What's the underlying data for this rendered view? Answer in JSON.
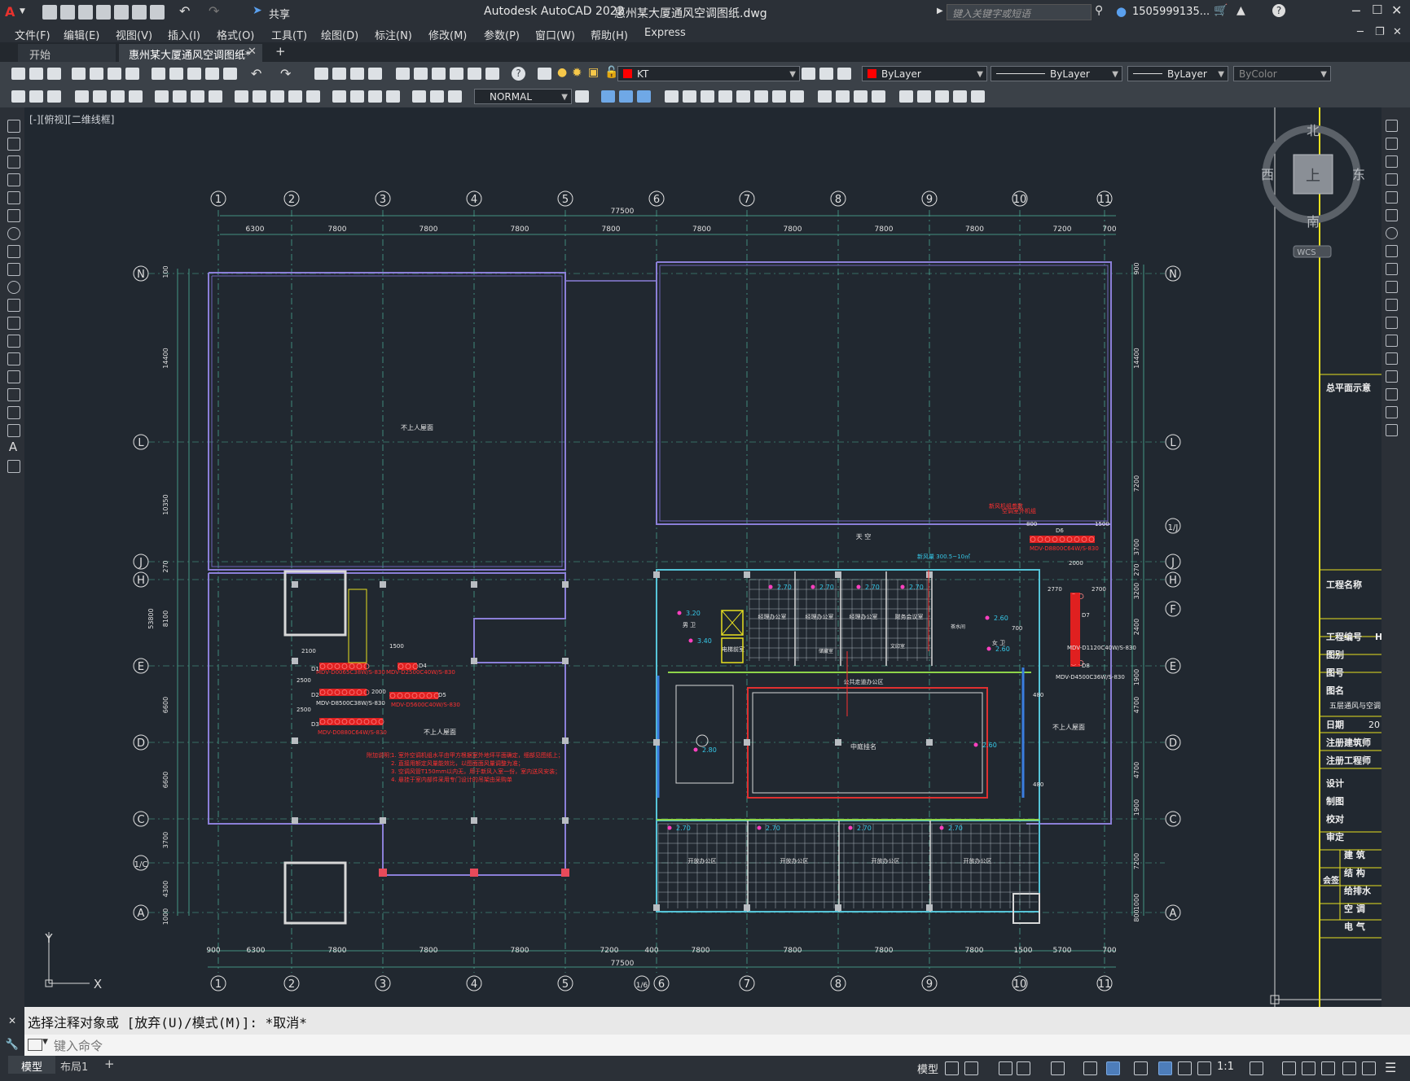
{
  "title_bar": {
    "app_title": "Autodesk AutoCAD 2022",
    "document_name": "惠州某大厦通风空调图纸.dwg",
    "share_label": "共享",
    "search_placeholder": "键入关键字或短语",
    "user": "1505999135..."
  },
  "menu": [
    "文件(F)",
    "编辑(E)",
    "视图(V)",
    "插入(I)",
    "格式(O)",
    "工具(T)",
    "绘图(D)",
    "标注(N)",
    "修改(M)",
    "参数(P)",
    "窗口(W)",
    "帮助(H)",
    "Express"
  ],
  "tabs": {
    "start": "开始",
    "active": "惠州某大厦通风空调图纸*",
    "add": "+"
  },
  "toolbar": {
    "layer": "KT",
    "color": "ByLayer",
    "linetype": "ByLayer",
    "lineweight": "ByLayer",
    "plotstyle": "ByColor",
    "dimstyle": "NORMAL",
    "layer_color": "#ff0000"
  },
  "viewport": {
    "label": "[-][俯视][二维线框]",
    "viewcube": {
      "north": "北",
      "south": "南",
      "east": "东",
      "west": "西",
      "face": "上",
      "wcs": "WCS"
    },
    "ucs_x": "X",
    "ucs_y": "Y"
  },
  "drawing": {
    "top_total": "77500",
    "bottom_total": "77500",
    "col_axes": [
      "1",
      "2",
      "3",
      "4",
      "5",
      "6",
      "7",
      "8",
      "9",
      "10",
      "11"
    ],
    "bottom_col_axes": [
      "1",
      "2",
      "3",
      "4",
      "5",
      "1/6",
      "6",
      "7",
      "8",
      "9",
      "10",
      "11"
    ],
    "top_dims": [
      "6300",
      "7800",
      "7800",
      "7800",
      "7800",
      "7800",
      "7800",
      "7800",
      "7800",
      "7200",
      "700"
    ],
    "bottom_dims": [
      "900",
      "6300",
      "7800",
      "7800",
      "7800",
      "7200",
      "400",
      "7800",
      "7800",
      "7800",
      "7800",
      "1500",
      "5700",
      "700"
    ],
    "row_axes_left": [
      "N",
      "L",
      "J",
      "H",
      "E",
      "D",
      "C",
      "1/C",
      "A"
    ],
    "row_axes_right": [
      "N",
      "L",
      "1/J",
      "J",
      "H",
      "F",
      "E",
      "D",
      "C",
      "A"
    ],
    "left_dims": [
      "100",
      "14400",
      "10350",
      "270",
      "53800",
      "8100",
      "6600",
      "6600",
      "3700",
      "4300",
      "1000"
    ],
    "right_dims": [
      "900",
      "14400",
      "7200",
      "3700",
      "270",
      "3200",
      "2400",
      "1900",
      "4700",
      "4700",
      "1900",
      "7200",
      "1000",
      "800"
    ],
    "rooms": {
      "nw_roof": "不上人屋面",
      "sw_roof": "不上人屋面",
      "east_roof": "不上人屋面",
      "atrium": "中庭挂名",
      "sky": "天 空",
      "office_small": [
        "经理办公室",
        "经理办公室",
        "经理办公室",
        "财务会议室"
      ],
      "office_large": [
        "开放办公区",
        "开放办公区",
        "开放办公区",
        "开放办公区"
      ],
      "corridor": "公共走道办公区",
      "elevator": "电梯前室",
      "restroom_m": "男 卫",
      "restroom_f": "女 卫",
      "tea": "茶水间",
      "storage": "储藏室",
      "copy": "文印室"
    },
    "equipment_labels": {
      "mdv_w1": "MDV-D0065C38W/S-830",
      "mdv_w2": "MDV-D8500C38W/S-830",
      "mdv_w3": "MDV-D0880C64W/S-830",
      "mdv_w4": "MDV-D2500C40W/S-830",
      "mdv_w5": "MDV-D5600C40W/S-830",
      "mdv_e1": "MDV-D8800C64W/S-830",
      "mdv_e2": "MDV-D1120C40W/S-830",
      "mdv_e3": "MDV-D4500C36W/S-830",
      "d_labels": [
        "D1",
        "D2",
        "D3",
        "D4",
        "D5",
        "D6",
        "D7",
        "D8"
      ],
      "fresh_air": "新风机组参数",
      "vent_note": "空调室外机组",
      "supply": "新风量 300.5~10㎡"
    },
    "heights": [
      "3.20",
      "3.40",
      "2.70",
      "2.70",
      "2.70",
      "2.70",
      "2.60",
      "2.60",
      "2.80",
      "2.70",
      "2.70",
      "2.70",
      "2.70",
      "2.60"
    ],
    "dims_east": [
      "800",
      "1500",
      "2000",
      "2770",
      "2700",
      "700",
      "480",
      "480"
    ],
    "notes_west": {
      "title": "附加说明：",
      "items": [
        "1. 室外空调机组水平由甲方根据室外地坪平面确定，细部见图纸上；",
        "2. 直接用额定风量能效比，以图面面风量调整为准；",
        "3. 空调风管T150mm以内无，用于新风入室一份，室内送风安装；",
        "4. 悬挂于室内部件采用专门设计的吊架由采购单"
      ]
    },
    "dim_labels_west": [
      "2100",
      "1500",
      "2000",
      "2500",
      "2500"
    ]
  },
  "title_block": {
    "plan_label": "总平面示意",
    "project_name_label": "工程名称",
    "project_no_label": "工程编号",
    "drawing_label": "图别",
    "sheet_no_label": "图号",
    "sheet_name_label": "图名",
    "sheet_name": "五层通风与空调",
    "date_label": "日期",
    "date_value": "20",
    "arch_label": "注册建筑师",
    "eng_label": "注册工程师",
    "design": "设计",
    "drawing": "制图",
    "check": "校对",
    "review": "审定",
    "countersign": "会签",
    "disciplines": [
      "建 筑",
      "结 构",
      "给排水",
      "空 调",
      "电 气"
    ],
    "project_no_value": "H"
  },
  "command": {
    "history": "选择注释对象或 [放弃(U)/模式(M)]: *取消*",
    "placeholder": "键入命令"
  },
  "statusbar": {
    "model_tab": "模型",
    "layout_tab": "布局1",
    "add_tab": "+",
    "model_space": "模型",
    "scale": "1:1"
  }
}
